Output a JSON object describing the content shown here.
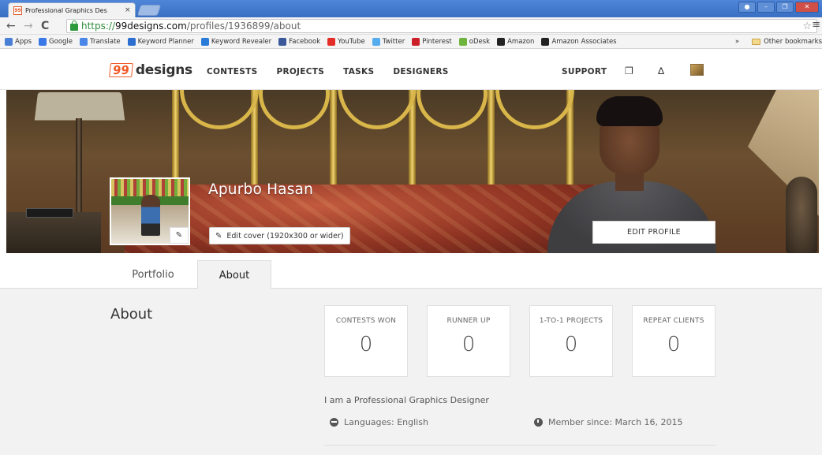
{
  "browser": {
    "tab_title": "Professional Graphics Des",
    "tab_favicon": "99",
    "tab_close": "×",
    "url_scheme": "https://",
    "url_host": "99designs.com",
    "url_path": "/profiles/1936899/about",
    "bookmarks": [
      {
        "label": "Apps",
        "icon": "apps-icon",
        "color": "#4a7fd6"
      },
      {
        "label": "Google",
        "icon": "google-icon",
        "color": "#3b78e7"
      },
      {
        "label": "Translate",
        "icon": "translate-icon",
        "color": "#4a86e8"
      },
      {
        "label": "Keyword Planner",
        "icon": "adwords-icon",
        "color": "#2d6fd0"
      },
      {
        "label": "Keyword Revealer",
        "icon": "k-icon",
        "color": "#2a7bd8"
      },
      {
        "label": "Facebook",
        "icon": "facebook-icon",
        "color": "#3b5998"
      },
      {
        "label": "YouTube",
        "icon": "youtube-icon",
        "color": "#e52d27"
      },
      {
        "label": "Twitter",
        "icon": "twitter-icon",
        "color": "#55acee"
      },
      {
        "label": "Pinterest",
        "icon": "pinterest-icon",
        "color": "#cb2027"
      },
      {
        "label": "oDesk",
        "icon": "odesk-icon",
        "color": "#6fb43f"
      },
      {
        "label": "Amazon",
        "icon": "amazon-icon",
        "color": "#222222"
      },
      {
        "label": "Amazon Associates",
        "icon": "amazon-icon",
        "color": "#222222"
      }
    ],
    "bookmarks_overflow": "»",
    "other_bookmarks": "Other bookmarks"
  },
  "site": {
    "logo_num": "99",
    "logo_word": "designs",
    "nav": [
      "CONTESTS",
      "PROJECTS",
      "TASKS",
      "DESIGNERS"
    ],
    "support": "SUPPORT"
  },
  "profile": {
    "name": "Apurbo Hasan",
    "edit_cover_label": "Edit cover (1920x300 or wider)",
    "edit_profile_label": "EDIT PROFILE"
  },
  "tabs": {
    "portfolio": "Portfolio",
    "about": "About"
  },
  "about": {
    "heading": "About",
    "stats": [
      {
        "label": "CONTESTS WON",
        "value": "0"
      },
      {
        "label": "RUNNER UP",
        "value": "0"
      },
      {
        "label": "1-TO-1 PROJECTS",
        "value": "0"
      },
      {
        "label": "REPEAT CLIENTS",
        "value": "0"
      }
    ],
    "bio": "I am a Professional Graphics Designer",
    "languages": "Languages: English",
    "member_since": "Member since: March 16, 2015"
  },
  "colors": {
    "brand_orange": "#f05a28",
    "chrome_blue": "#3a6fc4",
    "content_bg": "#f2f2f2"
  }
}
